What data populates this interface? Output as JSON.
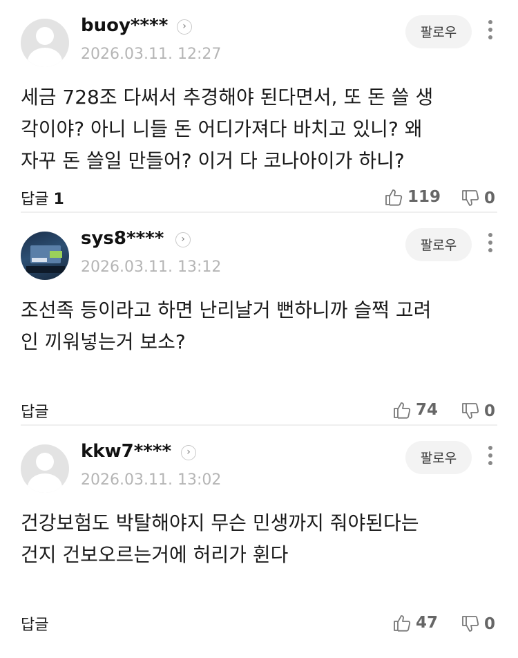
{
  "follow_label": "팔로우",
  "reply_label": "답글",
  "comments": [
    {
      "username": "buoy****",
      "date": "2026.03.11. 12:27",
      "text_lines": [
        "세금 728조 다써서 추경해야 된다면서, 또 돈 쓸 생",
        "각이야? 아니 니들 돈 어디가져다 바치고 있니? 왜",
        "자꾸 돈 쓸일 만들어? 이거 다 코나아이가 하니?"
      ],
      "reply_count": "1",
      "likes": "119",
      "dislikes": "0"
    },
    {
      "username": "sys8****",
      "date": "2026.03.11. 13:12",
      "text_lines": [
        "조선족 등이라고 하면 난리날거 뻔하니까 슬쩍 고려",
        "인 끼워넣는거 보소?"
      ],
      "reply_count": "",
      "likes": "74",
      "dislikes": "0"
    },
    {
      "username": "kkw7****",
      "date": "2026.03.11. 13:02",
      "text_lines": [
        "건강보험도 박탈해야지 무슨 민생까지 줘야된다는",
        "건지 건보오르는거에 허리가 휜다"
      ],
      "reply_count": "",
      "likes": "47",
      "dislikes": "0"
    }
  ]
}
